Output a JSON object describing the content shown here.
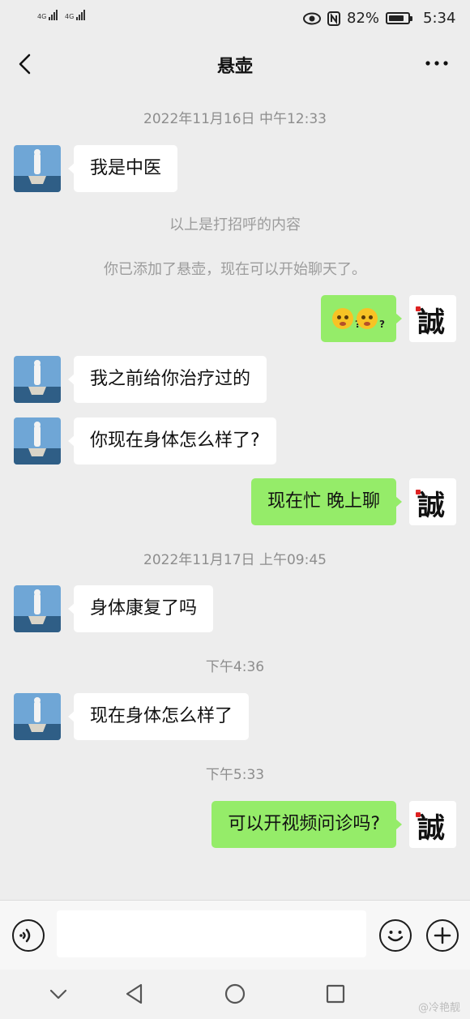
{
  "status": {
    "network_left": "4G",
    "network_right": "4G",
    "battery": "82%",
    "battery_level": 0.82,
    "time": "5:34"
  },
  "header": {
    "title": "悬壶"
  },
  "messages": [
    {
      "type": "time",
      "text": "2022年11月16日 中午12:33"
    },
    {
      "type": "in",
      "text": "我是中医"
    },
    {
      "type": "system",
      "text": "以上是打招呼的内容"
    },
    {
      "type": "system",
      "text": "你已添加了悬壶，现在可以开始聊天了。"
    },
    {
      "type": "out-emoji",
      "emoji": "confused-face-emoji"
    },
    {
      "type": "in",
      "text": "我之前给你治疗过的"
    },
    {
      "type": "in",
      "text": "你现在身体怎么样了?"
    },
    {
      "type": "out",
      "text": "现在忙  晚上聊"
    },
    {
      "type": "time",
      "text": "2022年11月17日 上午09:45"
    },
    {
      "type": "in",
      "text": "身体康复了吗"
    },
    {
      "type": "time",
      "text": "下午4:36"
    },
    {
      "type": "in",
      "text": "现在身体怎么样了"
    },
    {
      "type": "time",
      "text": "下午5:33"
    },
    {
      "type": "out",
      "text": "可以开视频问诊吗?"
    }
  ],
  "self_avatar_char": "誠",
  "watermark": "@冷艳靓",
  "colors": {
    "bg": "#ededed",
    "out_bubble": "#95ec69",
    "in_bubble": "#ffffff"
  }
}
